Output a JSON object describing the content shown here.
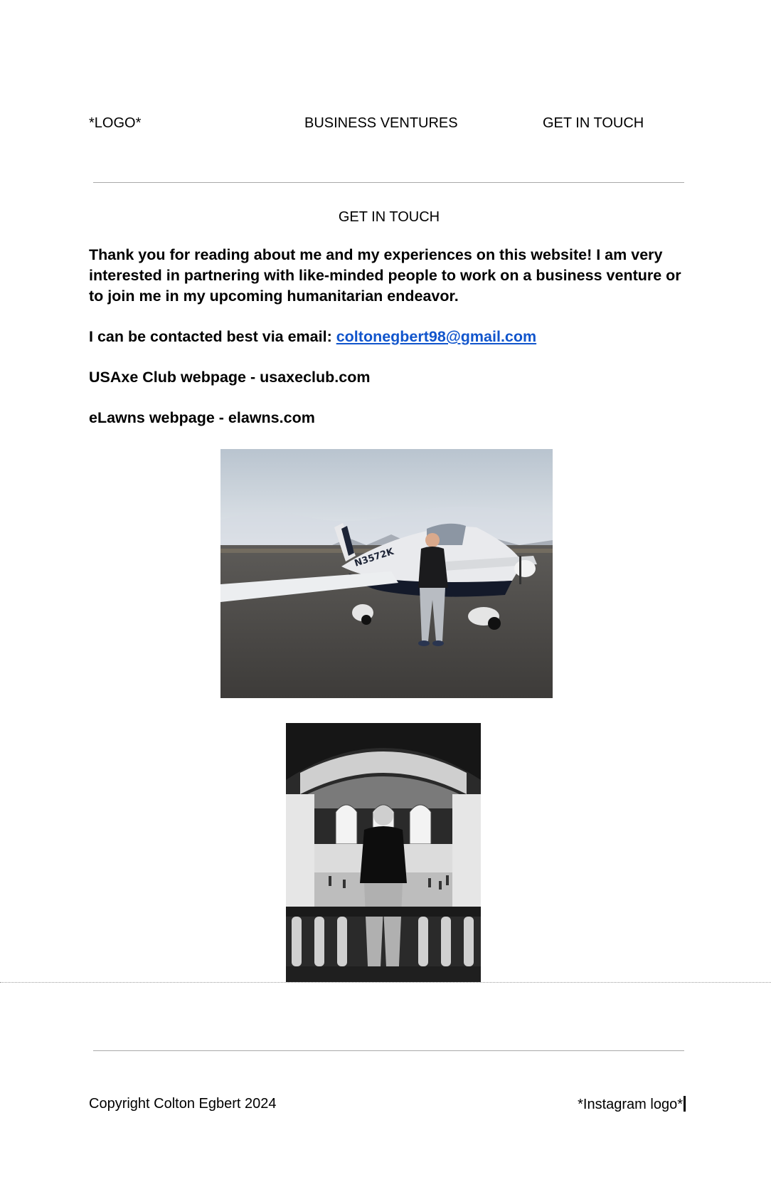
{
  "nav": {
    "logo": "*LOGO*",
    "business_ventures": "BUSINESS VENTURES",
    "get_in_touch": "GET IN TOUCH"
  },
  "section": {
    "title": "GET IN TOUCH"
  },
  "content": {
    "intro": "Thank you for reading about me and my experiences on this website! I am very interested in partnering with like-minded people to work on a business venture or to join me in my upcoming humanitarian endeavor.",
    "contact_prefix": "I can be contacted best via email: ",
    "email": "coltonegbert98@gmail.com",
    "usaxe": "USAxe Club webpage - usaxeclub.com",
    "elawns": "eLawns webpage - elawns.com"
  },
  "images": {
    "airplane": "airplane-photo",
    "terminal": "grand-terminal-photo",
    "colors": {
      "link": "#1155cc",
      "rule": "#a9a9a9"
    }
  },
  "footer": {
    "copyright": "Copyright Colton Egbert 2024",
    "instagram": "*Instagram logo*"
  }
}
